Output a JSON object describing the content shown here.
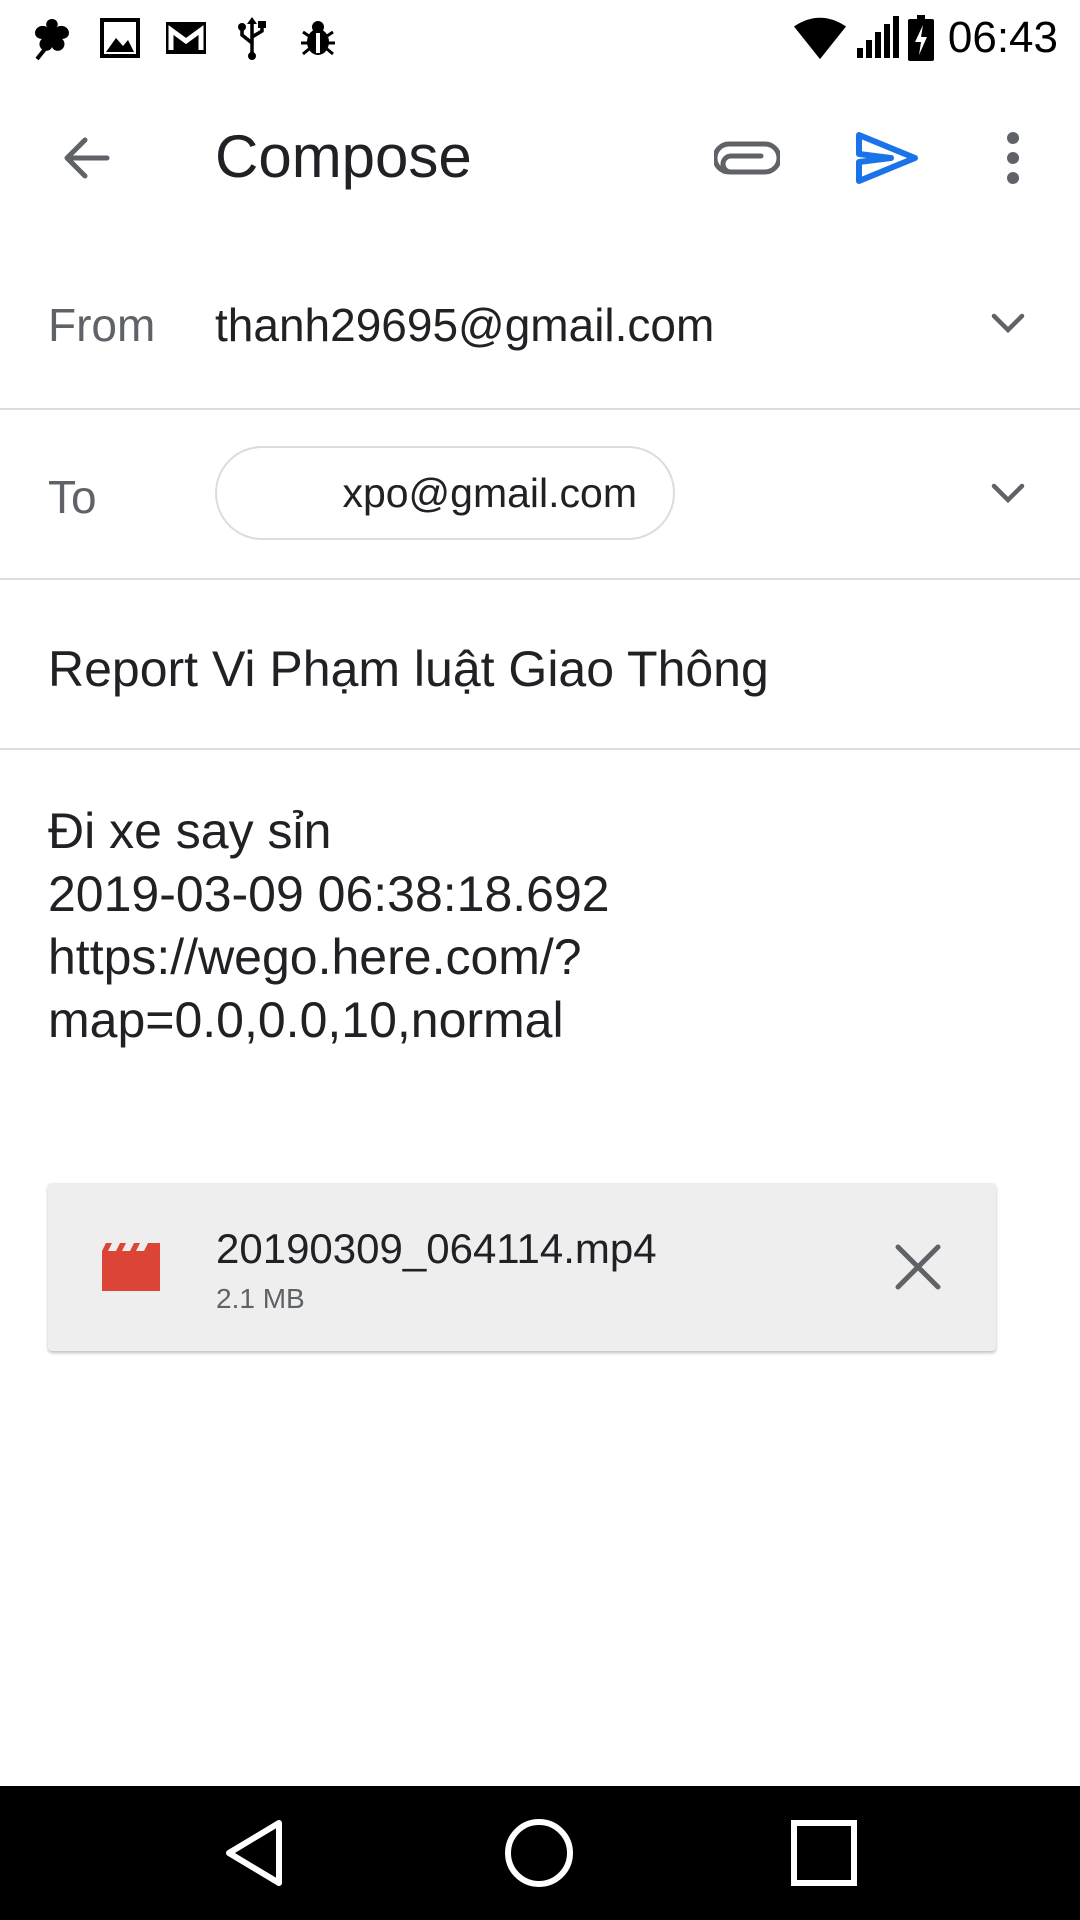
{
  "status_bar": {
    "time": "06:43",
    "icons": [
      "app-notification-icon",
      "image-icon",
      "gmail-icon",
      "usb-icon",
      "debug-icon",
      "wifi-icon",
      "signal-icon",
      "battery-charging-icon"
    ]
  },
  "app_bar": {
    "title": "Compose",
    "icons": [
      "back-arrow-icon",
      "attach-icon",
      "send-icon",
      "more-vert-icon"
    ],
    "accent_color": "#1a73e8"
  },
  "from": {
    "label": "From",
    "value": "thanh29695@gmail.com"
  },
  "to": {
    "label": "To",
    "recipient": "xpo@gmail.com"
  },
  "subject": "Report Vi Phạm luật Giao Thông",
  "body_lines": [
    "Đi xe say sỉn",
    "2019-03-09 06:38:18.692",
    "https://wego.here.com/?",
    "map=0.0,0.0,10,normal"
  ],
  "attachment": {
    "filename": "20190309_064114.mp4",
    "size": "2.1 MB",
    "icon": "video-file-icon",
    "icon_color": "#db4437"
  },
  "nav_bar": {
    "icons": [
      "nav-back-icon",
      "nav-home-icon",
      "nav-recents-icon"
    ]
  }
}
